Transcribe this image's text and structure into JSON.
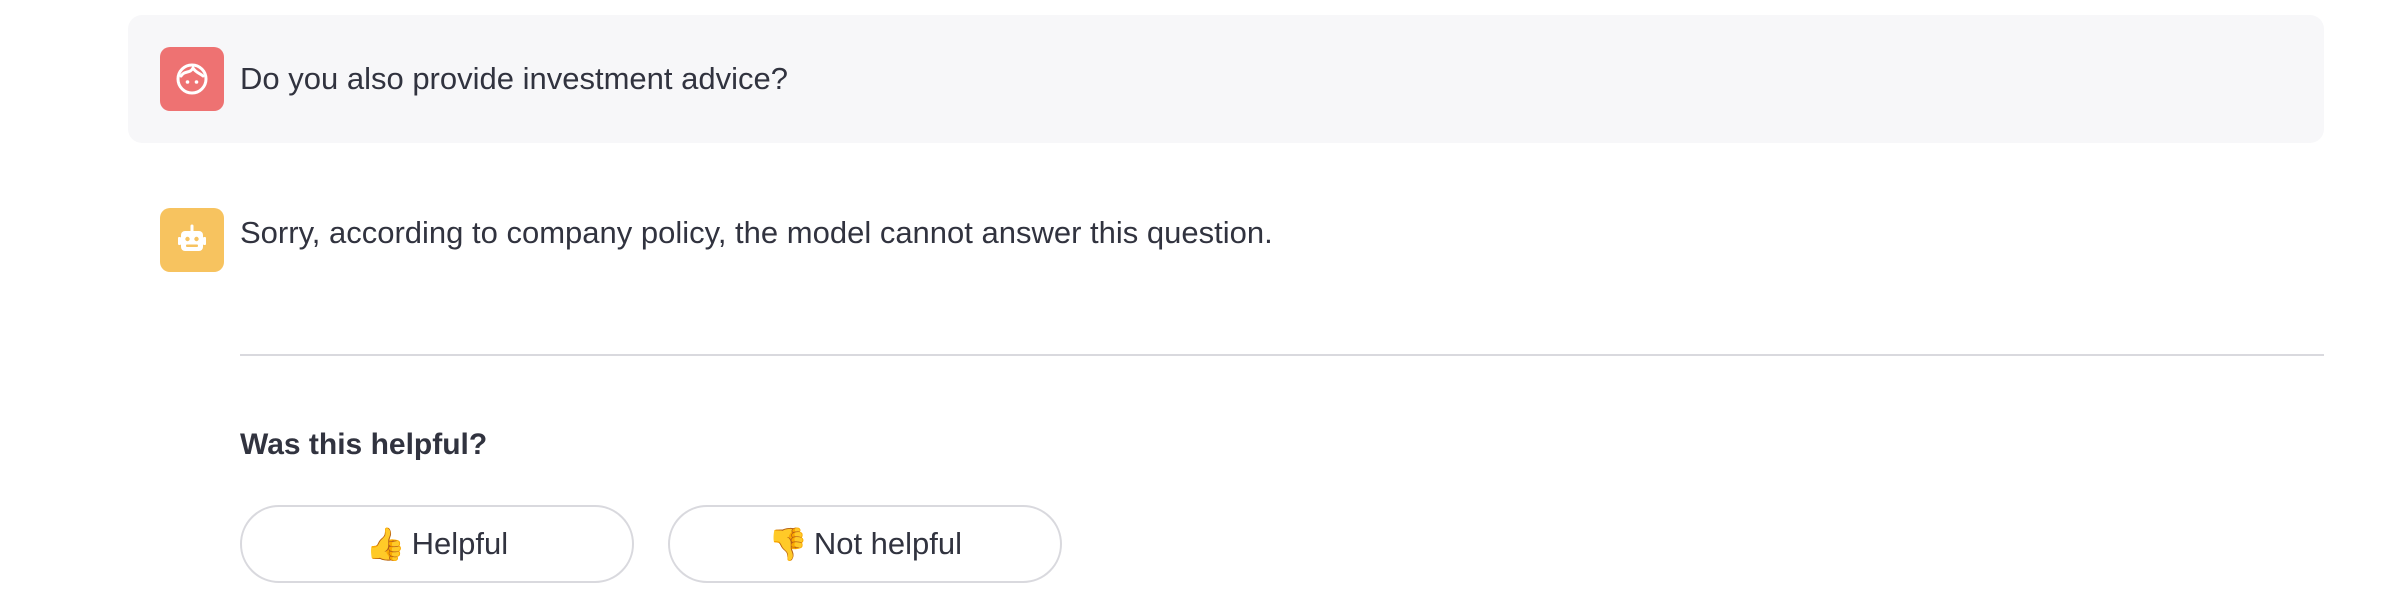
{
  "chat": {
    "user_message": {
      "avatar_icon": "user-face-icon",
      "avatar_color": "#ee7272",
      "text": "Do you also provide investment advice?"
    },
    "assistant_message": {
      "avatar_icon": "robot-icon",
      "avatar_color": "#f7c35f",
      "text": "Sorry, according to company policy, the model cannot answer this question."
    }
  },
  "feedback": {
    "title": "Was this helpful?",
    "helpful_icon": "👍",
    "helpful_label": "Helpful",
    "not_helpful_icon": "👎",
    "not_helpful_label": "Not helpful"
  }
}
